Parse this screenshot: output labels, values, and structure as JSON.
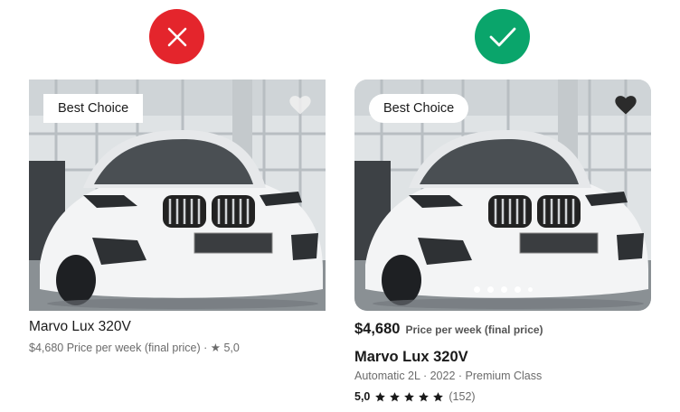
{
  "comparison": {
    "bad_icon": "cross-icon",
    "good_icon": "check-icon",
    "bad_color": "#e4252c",
    "good_color": "#0aa56b"
  },
  "bad_card": {
    "badge": "Best Choice",
    "favorite_icon": "heart-icon",
    "title": "Marvo Lux 320V",
    "subtitle": "$4,680 Price per week (final price) · ★ 5,0"
  },
  "good_card": {
    "badge": "Best Choice",
    "favorite_icon": "heart-icon",
    "price": "$4,680",
    "price_caption": "Price per week (final price)",
    "title": "Marvo Lux 320V",
    "specs": "Automatic 2L · 2022 · Premium Class",
    "rating": "5,0",
    "stars": 5,
    "reviews": "(152)",
    "carousel_dots": 5,
    "active_dot": 1
  }
}
